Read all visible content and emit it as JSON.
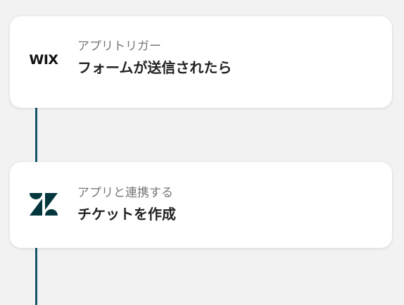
{
  "steps": [
    {
      "kind": "trigger",
      "app_logo": "wix-logo",
      "logo_text": "WIX",
      "subtitle": "アプリトリガー",
      "title": "フォームが送信されたら"
    },
    {
      "kind": "action",
      "app_logo": "zendesk-logo",
      "subtitle": "アプリと連携する",
      "title": "チケットを作成"
    }
  ],
  "colors": {
    "background": "#f2f2f2",
    "connector": "#14576b",
    "card": "#ffffff",
    "subtitle": "#777777",
    "title": "#222222",
    "zendesk": "#03363d"
  }
}
